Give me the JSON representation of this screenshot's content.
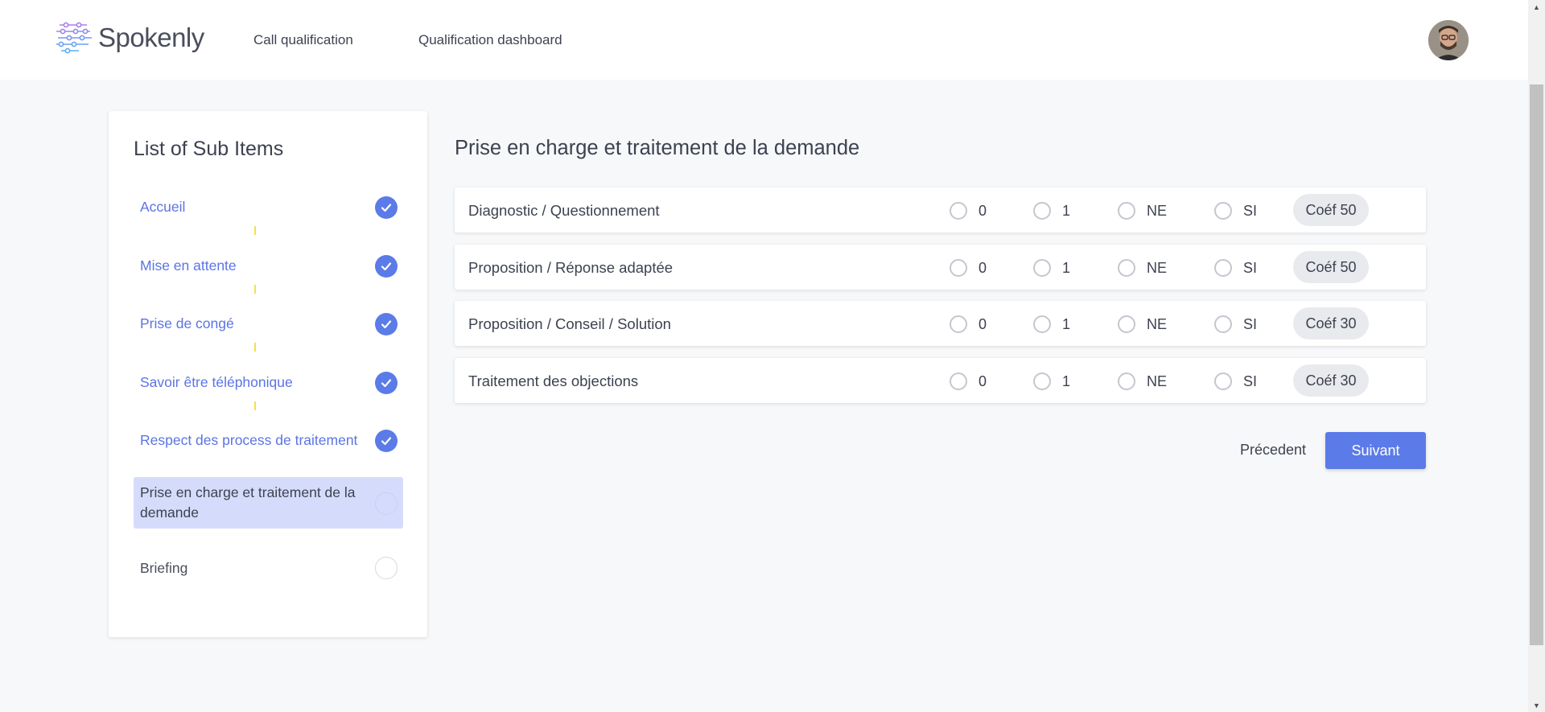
{
  "header": {
    "logo_text": "Spokenly",
    "nav": [
      "Call qualification",
      "Qualification dashboard"
    ]
  },
  "sidebar": {
    "title": "List of Sub Items",
    "items": [
      {
        "label": "Accueil",
        "status": "completed"
      },
      {
        "label": "Mise en attente",
        "status": "completed"
      },
      {
        "label": "Prise de congé",
        "status": "completed"
      },
      {
        "label": "Savoir être téléphonique",
        "status": "completed"
      },
      {
        "label": "Respect des process de traitement",
        "status": "completed"
      },
      {
        "label": "Prise en charge et traitement de la demande",
        "status": "active"
      },
      {
        "label": "Briefing",
        "status": "pending"
      }
    ]
  },
  "main": {
    "title": "Prise en charge et traitement de la demande",
    "options": [
      "0",
      "1",
      "NE",
      "SI"
    ],
    "rows": [
      {
        "label": "Diagnostic / Questionnement",
        "coef": "Coéf 50"
      },
      {
        "label": "Proposition / Réponse adaptée",
        "coef": "Coéf 50"
      },
      {
        "label": "Proposition / Conseil / Solution",
        "coef": "Coéf 30"
      },
      {
        "label": "Traitement des objections",
        "coef": "Coéf 30"
      }
    ],
    "prev_label": "Précedent",
    "next_label": "Suivant"
  },
  "colors": {
    "accent": "#5b7be8",
    "active_bg": "#d5dcfb",
    "connector": "#f2e24a"
  }
}
